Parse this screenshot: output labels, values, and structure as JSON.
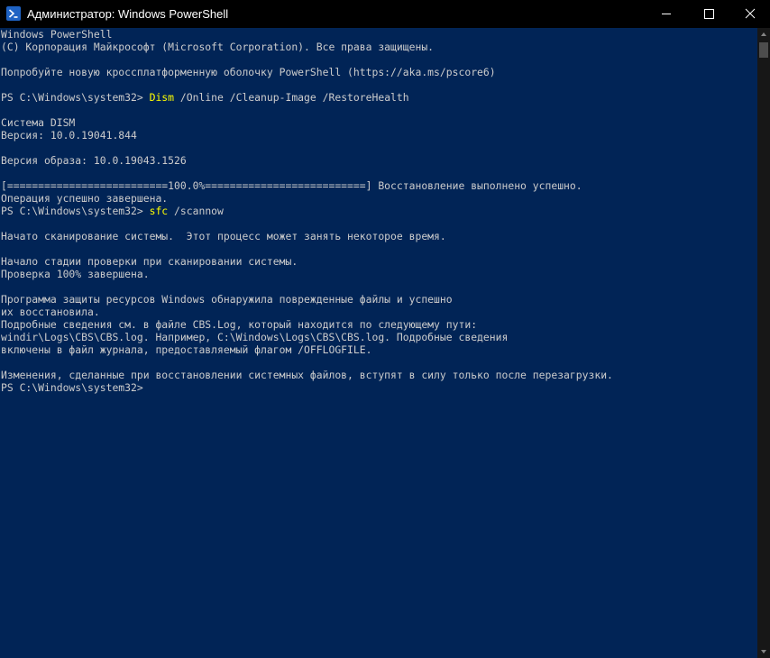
{
  "window": {
    "title": "Администратор: Windows PowerShell",
    "icon": "powershell-icon",
    "controls": [
      "minimize-icon",
      "maximize-icon",
      "close-icon"
    ]
  },
  "colors": {
    "console_background": "#012456",
    "text": "#cccccc",
    "command": "#ffff00",
    "titlebar": "#000000"
  },
  "console": {
    "lines": [
      "Windows PowerShell",
      "(C) Корпорация Майкрософт (Microsoft Corporation). Все права защищены.",
      "",
      "Попробуйте новую кроссплатформенную оболочку PowerShell (https://aka.ms/pscore6)",
      "",
      {
        "prompt": "PS C:\\Windows\\system32> ",
        "command": "Dism",
        "args": " /Online /Cleanup-Image /RestoreHealth"
      },
      "",
      "Система DISM",
      "Версия: 10.0.19041.844",
      "",
      "Версия образа: 10.0.19043.1526",
      "",
      "[==========================100.0%==========================] Восстановление выполнено успешно.",
      "Операция успешно завершена.",
      {
        "prompt": "PS C:\\Windows\\system32> ",
        "command": "sfc",
        "args": " /scannow"
      },
      "",
      "Начато сканирование системы.  Этот процесс может занять некоторое время.",
      "",
      "Начало стадии проверки при сканировании системы.",
      "Проверка 100% завершена.",
      "",
      "Программа защиты ресурсов Windows обнаружила поврежденные файлы и успешно",
      "их восстановила.",
      "Подробные сведения см. в файле CBS.Log, который находится по следующему пути:",
      "windir\\Logs\\CBS\\CBS.log. Например, C:\\Windows\\Logs\\CBS\\CBS.log. Подробные сведения",
      "включены в файл журнала, предоставляемый флагом /OFFLOGFILE.",
      "",
      "Изменения, сделанные при восстановлении системных файлов, вступят в силу только после перезагрузки.",
      {
        "prompt": "PS C:\\Windows\\system32> ",
        "command": "",
        "args": ""
      }
    ]
  },
  "scrollbar": {
    "up_icon": "scroll-up-arrow-icon",
    "down_icon": "scroll-down-arrow-icon",
    "position": 0
  }
}
